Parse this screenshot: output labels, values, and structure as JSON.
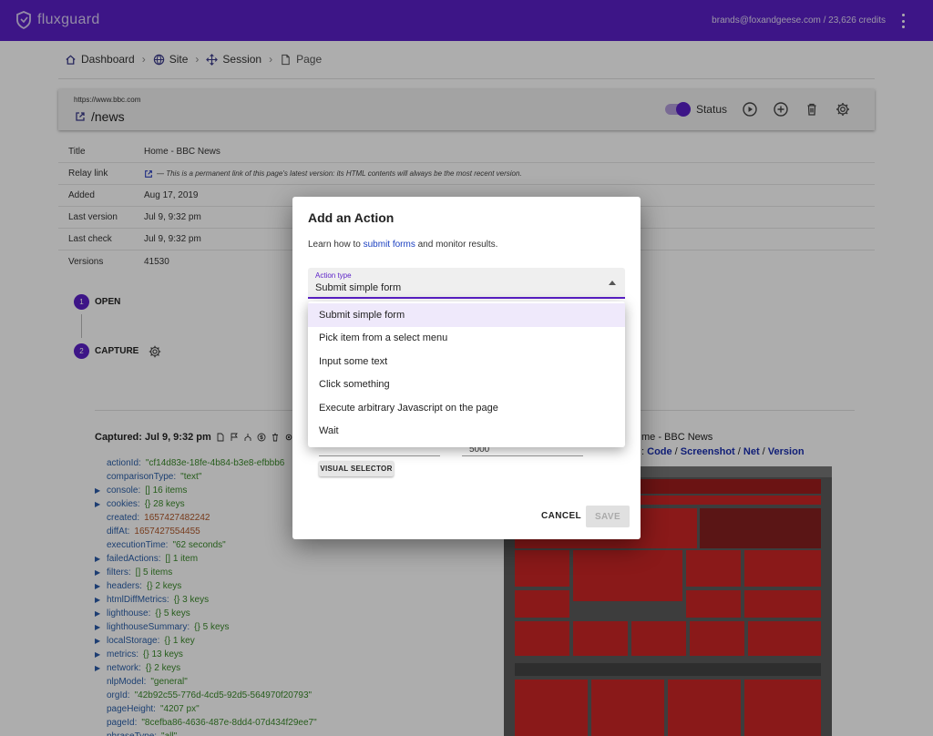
{
  "app": {
    "brand": "fluxguard",
    "account": "brands@foxandgeese.com / 23,626 credits",
    "accent": "#5a1fc7"
  },
  "breadcrumb": [
    {
      "label": "Dashboard",
      "icon": "home-icon"
    },
    {
      "label": "Site",
      "icon": "globe-icon"
    },
    {
      "label": "Session",
      "icon": "move-icon"
    },
    {
      "label": "Page",
      "icon": "file-icon"
    }
  ],
  "page": {
    "url": "https://www.bbc.com",
    "path": "/news",
    "status_label": "Status"
  },
  "info": [
    {
      "label": "Title",
      "value": "Home - BBC News"
    },
    {
      "label": "Relay link",
      "value": "— This is a permanent link of this page's latest version: its HTML contents will always be the most recent version."
    },
    {
      "label": "Added",
      "value": "Aug 17, 2019"
    },
    {
      "label": "Last version",
      "value": "Jul 9, 9:32 pm"
    },
    {
      "label": "Last check",
      "value": "Jul 9, 9:32 pm"
    },
    {
      "label": "Versions",
      "value": "41530"
    }
  ],
  "steps": [
    {
      "num": "1",
      "label": "OPEN"
    },
    {
      "num": "2",
      "label": "CAPTURE"
    }
  ],
  "captured": {
    "heading": "Captured: Jul 9, 9:32 pm",
    "rows": [
      {
        "arrow": "",
        "key": "actionId:",
        "value": "\"cf14d83e-18fe-4b84-b3e8-efbbb6",
        "type": "str"
      },
      {
        "arrow": "",
        "key": "comparisonType:",
        "value": "\"text\"",
        "type": "str"
      },
      {
        "arrow": "▶",
        "key": "console:",
        "value": "[]  16 items",
        "type": "obj"
      },
      {
        "arrow": "▶",
        "key": "cookies:",
        "value": "{}  28 keys",
        "type": "obj"
      },
      {
        "arrow": "",
        "key": "created:",
        "value": "1657427482242",
        "type": "num"
      },
      {
        "arrow": "",
        "key": "diffAt:",
        "value": "1657427554455",
        "type": "num"
      },
      {
        "arrow": "",
        "key": "executionTime:",
        "value": "\"62 seconds\"",
        "type": "str"
      },
      {
        "arrow": "▶",
        "key": "failedActions:",
        "value": "[]  1 item",
        "type": "obj"
      },
      {
        "arrow": "▶",
        "key": "filters:",
        "value": "[]  5 items",
        "type": "obj"
      },
      {
        "arrow": "▶",
        "key": "headers:",
        "value": "{}  2 keys",
        "type": "obj"
      },
      {
        "arrow": "▶",
        "key": "htmlDiffMetrics:",
        "value": "{}  3 keys",
        "type": "obj"
      },
      {
        "arrow": "▶",
        "key": "lighthouse:",
        "value": "{}  5 keys",
        "type": "obj"
      },
      {
        "arrow": "▶",
        "key": "lighthouseSummary:",
        "value": "{}  5 keys",
        "type": "obj"
      },
      {
        "arrow": "▶",
        "key": "localStorage:",
        "value": "{}  1 key",
        "type": "obj"
      },
      {
        "arrow": "▶",
        "key": "metrics:",
        "value": "{}  13 keys",
        "type": "obj"
      },
      {
        "arrow": "▶",
        "key": "network:",
        "value": "{}  2 keys",
        "type": "obj"
      },
      {
        "arrow": "",
        "key": "nlpModel:",
        "value": "\"general\"",
        "type": "str"
      },
      {
        "arrow": "",
        "key": "orgId:",
        "value": "\"42b92c55-776d-4cd5-92d5-564970f20793\"",
        "type": "str"
      },
      {
        "arrow": "",
        "key": "pageHeight:",
        "value": "\"4207 px\"",
        "type": "str"
      },
      {
        "arrow": "",
        "key": "pageId:",
        "value": "\"8cefba86-4636-487e-8dd4-07d434f29ee7\"",
        "type": "str"
      },
      {
        "arrow": "",
        "key": "phraseType:",
        "value": "\"all\"",
        "type": "str"
      }
    ]
  },
  "right": {
    "title": "me - BBC News",
    "links": [
      ": ",
      "Code",
      "Screenshot",
      "Net",
      "Version"
    ]
  },
  "dialog": {
    "title": "Add an Action",
    "help_prefix": "Learn how to ",
    "help_link": "submit forms",
    "help_suffix": " and monitor results.",
    "select_label": "Action type",
    "select_value": "Submit simple form",
    "visual_selector": "VISUAL SELECTOR",
    "ghost_value": "5000",
    "cancel": "CANCEL",
    "save": "SAVE"
  },
  "menu": [
    "Submit simple form",
    "Pick item from a select menu",
    "Input some text",
    "Click something",
    "Execute arbitrary Javascript on the page",
    "Wait"
  ]
}
